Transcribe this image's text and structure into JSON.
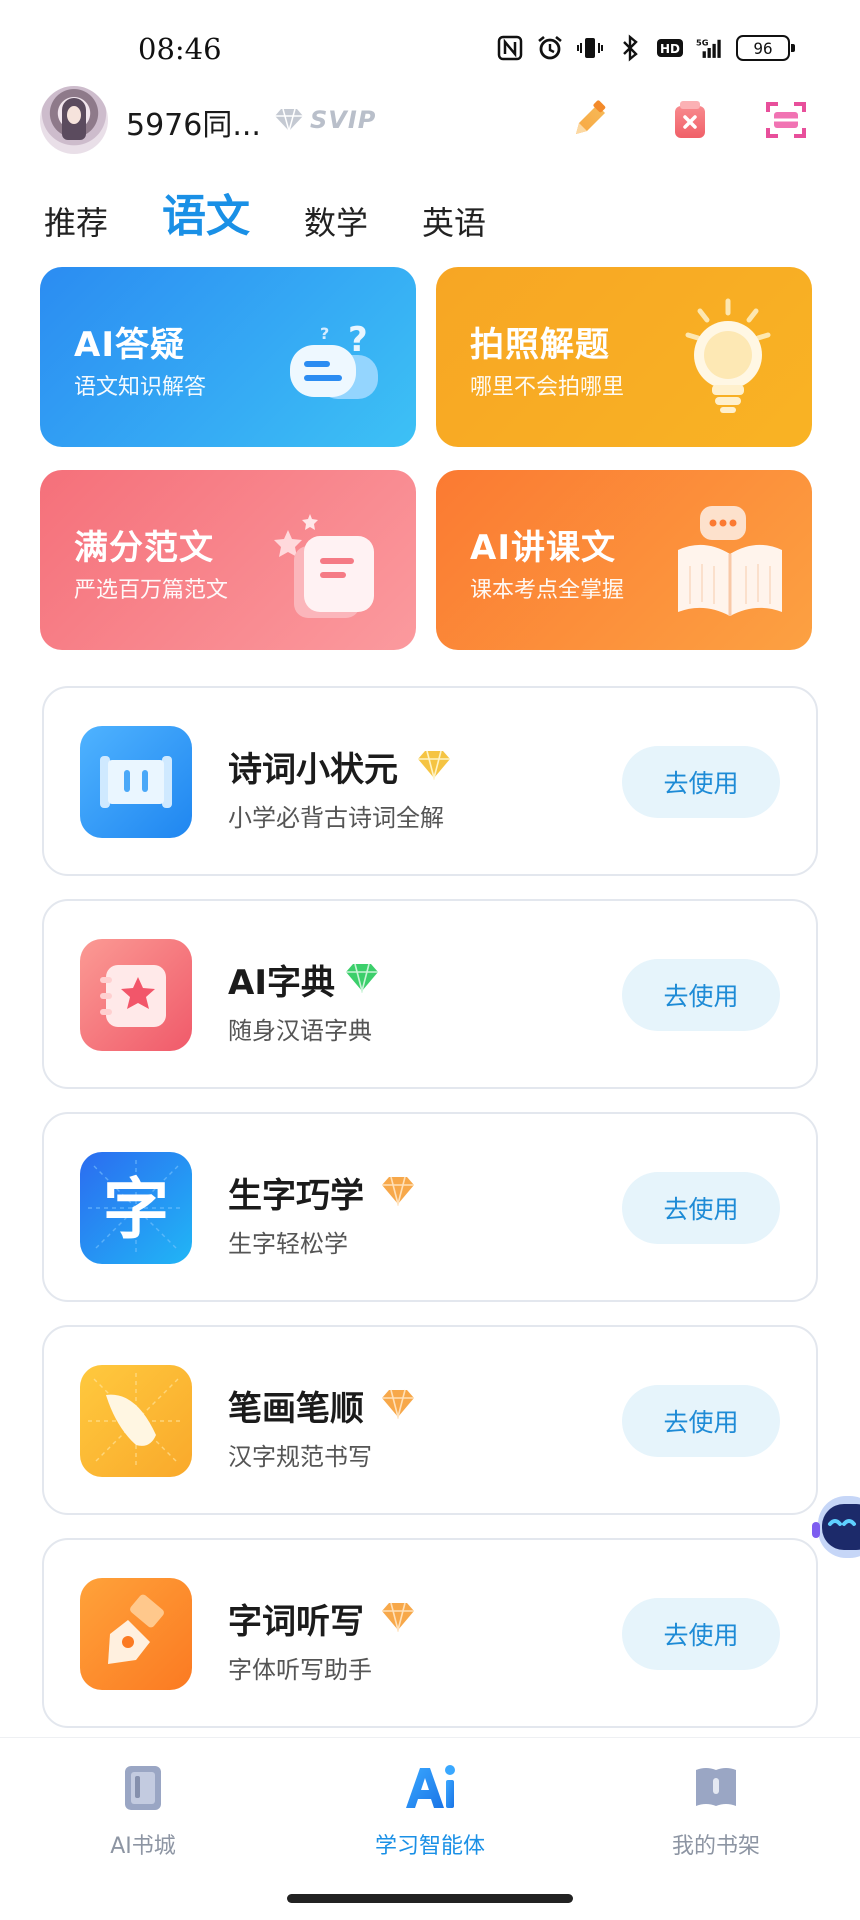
{
  "status_bar": {
    "time": "08:46",
    "icons": [
      "nfc-icon",
      "alarm-icon",
      "vibrate-icon",
      "bluetooth-icon",
      "hd-icon",
      "signal-5g-icon"
    ],
    "battery": "96"
  },
  "header": {
    "username": "5976同...",
    "badge": "SVIP",
    "actions": [
      "edit-icon",
      "clear-icon",
      "scan-icon"
    ]
  },
  "tabs": [
    {
      "label": "推荐",
      "active": false
    },
    {
      "label": "语文",
      "active": true
    },
    {
      "label": "数学",
      "active": false
    },
    {
      "label": "英语",
      "active": false
    }
  ],
  "features": [
    {
      "title": "AI答疑",
      "subtitle": "语文知识解答",
      "icon": "chat-question-icon",
      "color": "#2b8cf2"
    },
    {
      "title": "拍照解题",
      "subtitle": "哪里不会拍哪里",
      "icon": "lightbulb-icon",
      "color": "#f7a624"
    },
    {
      "title": "满分范文",
      "subtitle": "严选百万篇范文",
      "icon": "document-star-icon",
      "color": "#f5707a"
    },
    {
      "title": "AI讲课文",
      "subtitle": "课本考点全掌握",
      "icon": "open-book-icon",
      "color": "#fb7a32"
    }
  ],
  "tools": [
    {
      "name": "诗词小状元",
      "desc": "小学必背古诗词全解",
      "button": "去使用",
      "icon": "scroll-icon",
      "gem_color": "#f5c443"
    },
    {
      "name": "AI字典",
      "desc": "随身汉语字典",
      "button": "去使用",
      "icon": "dictionary-icon",
      "gem_color": "#3ccf6b"
    },
    {
      "name": "生字巧学",
      "desc": "生字轻松学",
      "button": "去使用",
      "icon": "character-icon",
      "gem_color": "#f7a84a"
    },
    {
      "name": "笔画笔顺",
      "desc": "汉字规范书写",
      "button": "去使用",
      "icon": "stroke-icon",
      "gem_color": "#f7a84a"
    },
    {
      "name": "字词听写",
      "desc": "字体听写助手",
      "button": "去使用",
      "icon": "pen-nib-icon",
      "gem_color": "#f7a84a"
    }
  ],
  "bottom_nav": [
    {
      "label": "AI书城",
      "icon": "bookstore-icon",
      "active": false
    },
    {
      "label": "学习智能体",
      "icon": "ai-logo-icon",
      "active": true
    },
    {
      "label": "我的书架",
      "icon": "bookshelf-icon",
      "active": false
    }
  ],
  "colors": {
    "accent": "#1a90e6",
    "button_bg": "#e6f4fb",
    "card_border": "#e3e7ee"
  }
}
